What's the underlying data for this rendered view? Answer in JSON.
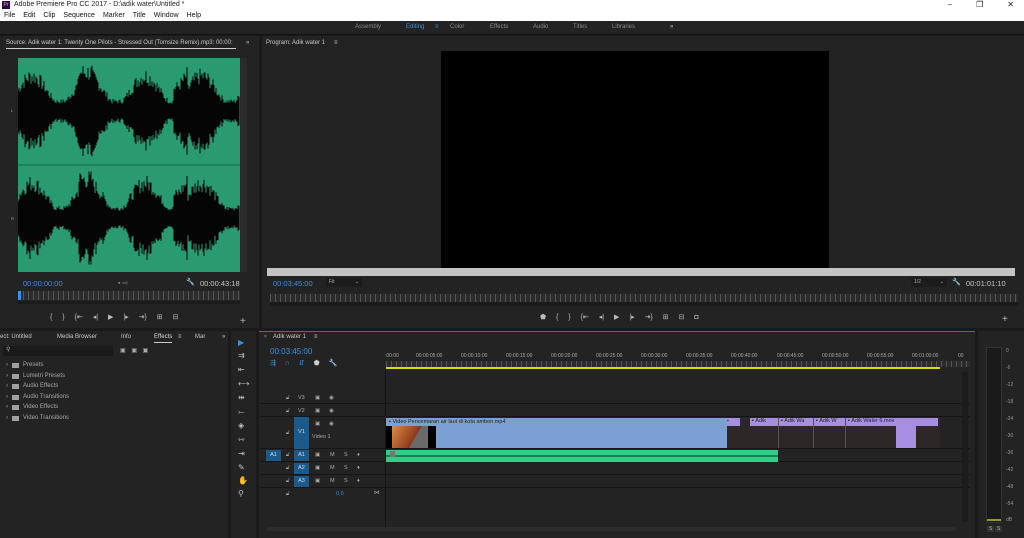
{
  "window": {
    "title": "Adobe Premiere Pro CC 2017 - D:\\adik water\\Untitled *",
    "logo": "Pr",
    "controls": [
      "–",
      "❐",
      "✕"
    ]
  },
  "menu": [
    "File",
    "Edit",
    "Clip",
    "Sequence",
    "Marker",
    "Title",
    "Window",
    "Help"
  ],
  "workspaces": {
    "items": [
      "Assembly",
      "Editing",
      "Color",
      "Effects",
      "Audio",
      "Titles",
      "Libraries"
    ],
    "active": "Editing",
    "more": "»"
  },
  "source": {
    "tab": "Source: Adik water 1: Twenty One Pilots - Stressed Out (Tomsize Remix).mp3: 00:00:",
    "more": "»",
    "timecode": "00:00:00:00",
    "duration": "00:00:43:18",
    "channels": [
      "L",
      "R"
    ],
    "colors": {
      "waveform_bg": "#2a9a70"
    }
  },
  "program": {
    "tab": "Program: Adik water 1",
    "timecode": "00:03:45:00",
    "zoom": "Fit",
    "resolution": "1/2",
    "duration": "00:01:01:10"
  },
  "effects": {
    "tabs": [
      "ect: Untitled",
      "Media Browser",
      "Info",
      "Effects",
      "Mar"
    ],
    "active": "Effects",
    "more": "»",
    "search_placeholder": "",
    "items": [
      "Presets",
      "Lumetri Presets",
      "Audio Effects",
      "Audio Transitions",
      "Video Effects",
      "Video Transitions"
    ]
  },
  "timeline": {
    "tab": "Adik water 1",
    "timecode": "00:03:45:00",
    "ruler": [
      ":00:00",
      "00:00:05:00",
      "00:00:10:00",
      "00:00:15:00",
      "00:00:20:00",
      "00:00:25:00",
      "00:00:30:00",
      "00:00:35:00",
      "00:00:40:00",
      "00:00:45:00",
      "00:00:50:00",
      "00:00:55:00",
      "00:01:00:00",
      "00"
    ],
    "tracks": {
      "v3": "V3",
      "v2": "V2",
      "v1": "V1",
      "v1_name": "Video 1",
      "a1": "A1",
      "a2": "A2",
      "a3": "A3",
      "a1_src": "A1",
      "m": "M",
      "s": "S",
      "master_vol": "0,0"
    },
    "clips": {
      "video_main": "Video Pencemaran air laut di kota ambon.mp4",
      "c2": "Adik",
      "c3": "Adik Wa",
      "c4": "Adik W",
      "c5": "Adik Water 6.mov"
    }
  },
  "meter": {
    "labels": [
      "0",
      "-6",
      "-12",
      "-18",
      "-24",
      "-30",
      "-36",
      "-42",
      "-48",
      "-54",
      "dB"
    ],
    "solo": [
      "S",
      "S"
    ]
  }
}
